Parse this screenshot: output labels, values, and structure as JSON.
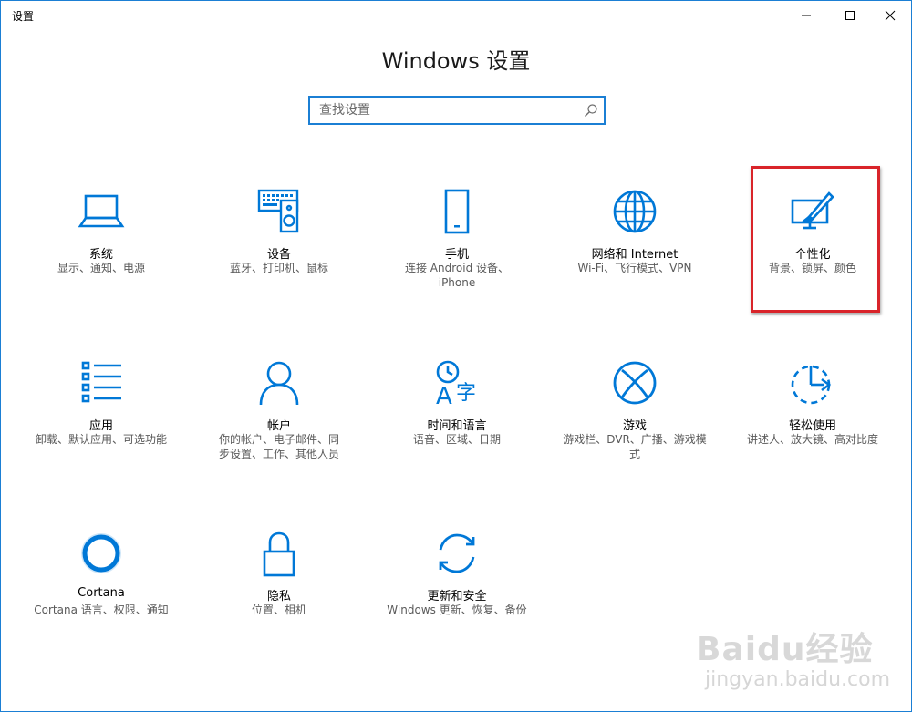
{
  "window": {
    "title": "设置",
    "controls": [
      "minimize-icon",
      "maximize-icon",
      "close-icon"
    ]
  },
  "heading": "Windows 设置",
  "search": {
    "placeholder": "查找设置",
    "value": ""
  },
  "accent_color": "#0078d7",
  "highlight_color": "#d9242a",
  "tiles": [
    {
      "icon": "laptop-icon",
      "label": "系统",
      "desc": "显示、通知、电源"
    },
    {
      "icon": "keyboard-speaker-icon",
      "label": "设备",
      "desc": "蓝牙、打印机、鼠标"
    },
    {
      "icon": "phone-icon",
      "label": "手机",
      "desc": "连接 Android 设备、iPhone"
    },
    {
      "icon": "globe-icon",
      "label": "网络和 Internet",
      "desc": "Wi-Fi、飞行模式、VPN"
    },
    {
      "icon": "personalization-icon",
      "label": "个性化",
      "desc": "背景、锁屏、颜色"
    },
    {
      "icon": "apps-list-icon",
      "label": "应用",
      "desc": "卸载、默认应用、可选功能"
    },
    {
      "icon": "person-icon",
      "label": "帐户",
      "desc": "你的帐户、电子邮件、同步设置、工作、其他人员"
    },
    {
      "icon": "time-language-icon",
      "label": "时间和语言",
      "desc": "语音、区域、日期"
    },
    {
      "icon": "xbox-icon",
      "label": "游戏",
      "desc": "游戏栏、DVR、广播、游戏模式"
    },
    {
      "icon": "ease-of-access-icon",
      "label": "轻松使用",
      "desc": "讲述人、放大镜、高对比度"
    },
    {
      "icon": "cortana-icon",
      "label": "Cortana",
      "desc": "Cortana 语言、权限、通知"
    },
    {
      "icon": "lock-icon",
      "label": "隐私",
      "desc": "位置、相机"
    },
    {
      "icon": "sync-icon",
      "label": "更新和安全",
      "desc": "Windows 更新、恢复、备份"
    }
  ],
  "watermark": {
    "brand": "Baidu经验",
    "url": "jingyan.baidu.com"
  }
}
